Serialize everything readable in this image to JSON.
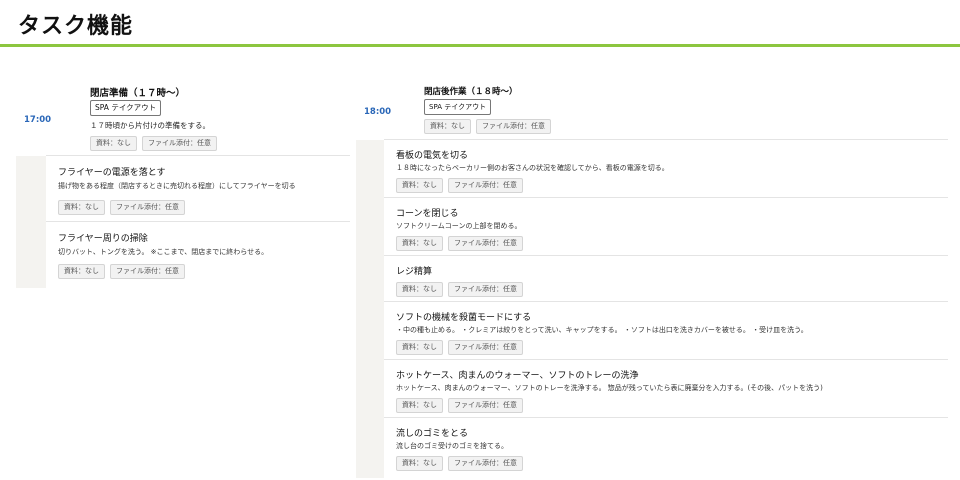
{
  "page": {
    "title": "タスク機能",
    "accent_color": "#8cc63f"
  },
  "badges": {
    "material": "資料：なし",
    "attachment": "ファイル添付：任意"
  },
  "left_section": {
    "time": "17:00",
    "title": "閉店準備（１７時〜）",
    "tag": "SPA テイクアウト",
    "description": "１７時頃から片付けの準備をする。",
    "tasks": [
      {
        "title": "フライヤーの電源を落とす",
        "description": "揚げ物をある程度（閉店するときに売切れる程度）にしてフライヤーを切る"
      },
      {
        "title": "フライヤー周りの掃除",
        "description": "切りバット、トングを洗う。 ※ここまで、閉店までに終わらせる。"
      }
    ]
  },
  "right_section": {
    "time": "18:00",
    "title": "閉店後作業（１８時〜）",
    "tag": "SPA テイクアウト",
    "tasks": [
      {
        "title": "看板の電気を切る",
        "description": "１８時になったらベーカリー側のお客さんの状況を確認してから、看板の電源を切る。"
      },
      {
        "title": "コーンを閉じる",
        "description": "ソフトクリームコーンの上部を閉める。"
      },
      {
        "title": "レジ精算",
        "description": ""
      },
      {
        "title": "ソフトの機械を殺菌モードにする",
        "description": "・中の種も止める。 ・クレミアは絞りをとって洗い、キャップをする。 ・ソフトは出口を洗きカバーを被せる。 ・受け皿を洗う。"
      },
      {
        "title": "ホットケース、肉まんのウォーマー、ソフトのトレーの洗浄",
        "description": "ホットケース、肉まんのウォーマー、ソフトのトレーを洗浄する。 惣品が残っていたら表に廃棄分を入力する。(その後、パットを洗う)"
      },
      {
        "title": "流しのゴミをとる",
        "description": "流し台のゴミ受けのゴミを捨てる。"
      }
    ]
  }
}
